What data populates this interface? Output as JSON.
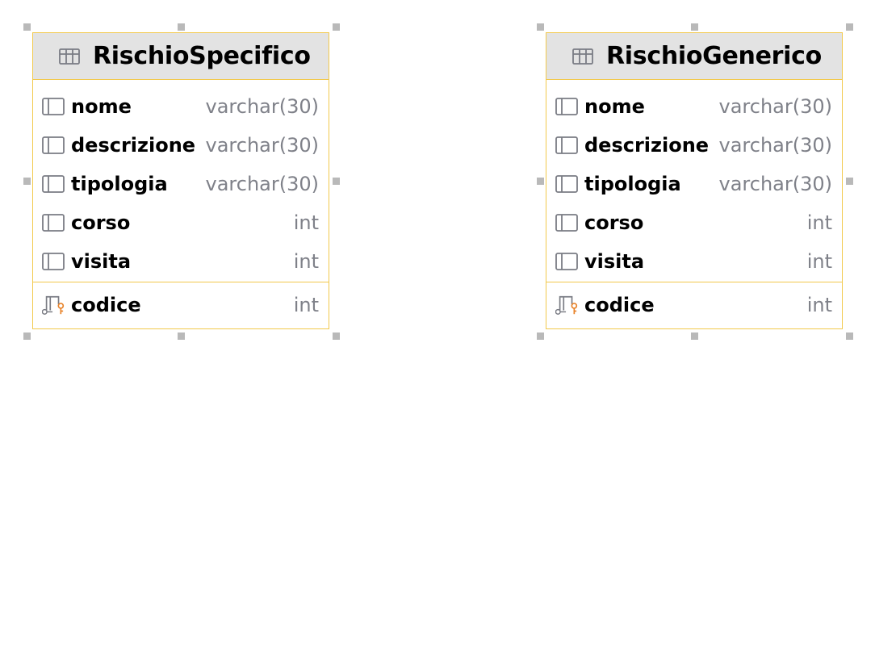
{
  "tables": [
    {
      "title": "RischioSpecifico",
      "columns": [
        {
          "name": "nome",
          "type": "varchar(30)"
        },
        {
          "name": "descrizione",
          "type": "varchar(30)"
        },
        {
          "name": "tipologia",
          "type": "varchar(30)"
        },
        {
          "name": "corso",
          "type": "int"
        },
        {
          "name": "visita",
          "type": "int"
        }
      ],
      "primary_key": {
        "name": "codice",
        "type": "int"
      }
    },
    {
      "title": "RischioGenerico",
      "columns": [
        {
          "name": "nome",
          "type": "varchar(30)"
        },
        {
          "name": "descrizione",
          "type": "varchar(30)"
        },
        {
          "name": "tipologia",
          "type": "varchar(30)"
        },
        {
          "name": "corso",
          "type": "int"
        },
        {
          "name": "visita",
          "type": "int"
        }
      ],
      "primary_key": {
        "name": "codice",
        "type": "int"
      }
    }
  ],
  "colors": {
    "border": "#f2c94c",
    "header_bg": "#e3e3e3",
    "type_text": "#7f8189",
    "key_icon": "#e8832a",
    "selection_handle": "#b9b9b9"
  },
  "icons": {
    "table": "table-grid-icon",
    "column": "column-icon",
    "primary_key": "primary-key-icon"
  }
}
